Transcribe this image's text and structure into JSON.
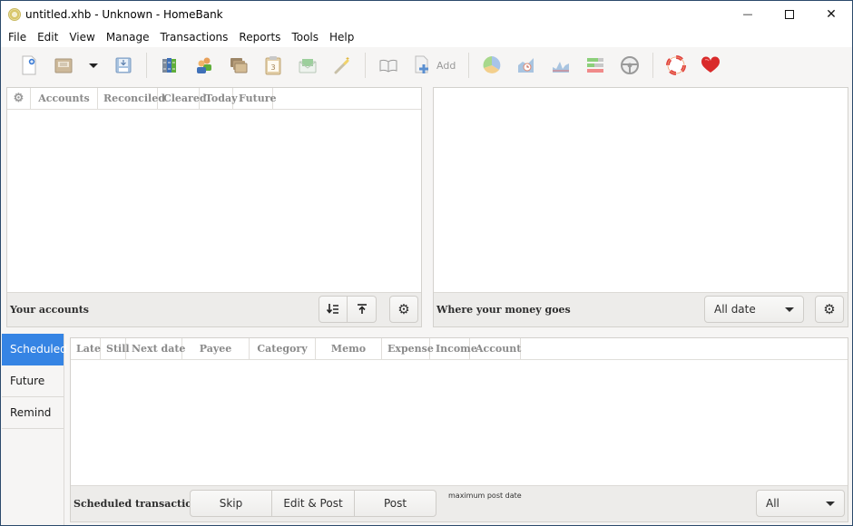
{
  "window": {
    "title": "untitled.xhb - Unknown - HomeBank",
    "controls": {
      "minimize": "—",
      "maximize": "☐",
      "close": "✕"
    }
  },
  "menubar": {
    "items": [
      "File",
      "Edit",
      "View",
      "Manage",
      "Transactions",
      "Reports",
      "Tools",
      "Help"
    ]
  },
  "toolbar": {
    "add_label": "Add",
    "buttons": [
      {
        "name": "new-file",
        "icon": "new-document-icon"
      },
      {
        "name": "open-file",
        "icon": "open-folder-icon"
      },
      {
        "name": "recent-dropdown",
        "icon": "chevron-down-icon"
      },
      {
        "name": "save-file",
        "icon": "save-icon"
      },
      {
        "name": "manage-accounts",
        "icon": "accounts-books-icon"
      },
      {
        "name": "manage-payees",
        "icon": "payees-people-icon"
      },
      {
        "name": "manage-categories",
        "icon": "categories-folders-icon"
      },
      {
        "name": "manage-scheduled",
        "icon": "calendar-clipboard-icon"
      },
      {
        "name": "manage-budget",
        "icon": "envelope-money-icon"
      },
      {
        "name": "assign-wand",
        "icon": "magic-wand-icon"
      },
      {
        "name": "show-transactions",
        "icon": "open-book-icon"
      },
      {
        "name": "add-transaction",
        "icon": "add-document-icon"
      },
      {
        "name": "report-statistics",
        "icon": "pie-chart-icon"
      },
      {
        "name": "report-trend",
        "icon": "trend-clock-icon"
      },
      {
        "name": "report-balance",
        "icon": "area-chart-icon"
      },
      {
        "name": "report-budget",
        "icon": "budget-bars-icon"
      },
      {
        "name": "report-vehicle",
        "icon": "steering-wheel-icon"
      },
      {
        "name": "help",
        "icon": "lifebuoy-icon"
      },
      {
        "name": "donate",
        "icon": "heart-icon"
      }
    ]
  },
  "accounts_panel": {
    "columns": [
      "Accounts",
      "Reconciled",
      "Cleared",
      "Today",
      "Future"
    ],
    "footer_label": "Your accounts",
    "rows": []
  },
  "spending_panel": {
    "footer_label": "Where your money goes",
    "range_selected": "All date"
  },
  "scheduled_panel": {
    "tabs": [
      {
        "label": "Scheduled",
        "active": true
      },
      {
        "label": "Future",
        "active": false
      },
      {
        "label": "Remind",
        "active": false
      }
    ],
    "columns": [
      "Late",
      "Still",
      "Next date",
      "Payee",
      "Category",
      "Memo",
      "Expense",
      "Income",
      "Account"
    ],
    "rows": [],
    "footer_label": "Scheduled transactions",
    "buttons": {
      "skip": "Skip",
      "edit_post": "Edit & Post",
      "post": "Post"
    },
    "max_post_label": "maximum post date",
    "max_post_selected": "All"
  },
  "colors": {
    "accent": "#3584e4",
    "window_border": "#2b4a6b"
  }
}
